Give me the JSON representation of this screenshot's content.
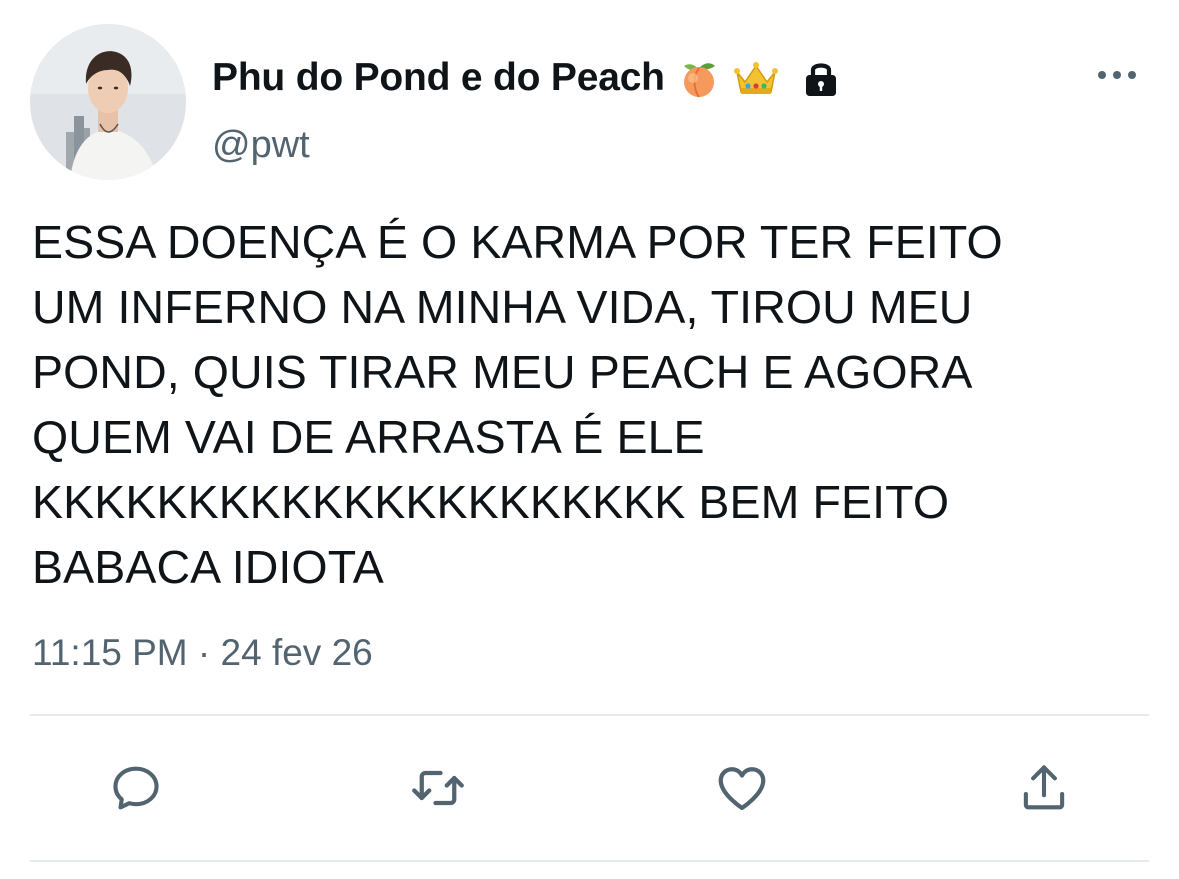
{
  "tweet": {
    "author": {
      "display_name": "Phu do Pond e do Peach",
      "handle": "@pwt",
      "badges": [
        "peach-emoji",
        "crown-emoji",
        "lock-icon"
      ]
    },
    "text": "ESSA DOENÇA É O KARMA POR TER FEITO\nUM INFERNO NA MINHA VIDA, TIROU MEU\nPOND, QUIS TIRAR MEU PEACH E AGORA\nQUEM VAI DE ARRASTA É ELE\nKKKKKKKKKKKKKKKKKKKKK BEM FEITO\nBABACA IDIOTA",
    "time": "11:15 PM",
    "separator": "·",
    "date": "24 fev 26"
  },
  "actions": [
    "reply-icon",
    "retweet-icon",
    "like-icon",
    "share-icon"
  ],
  "colors": {
    "text": "#0f1419",
    "secondary": "#536471",
    "divider": "#e6ebee"
  }
}
